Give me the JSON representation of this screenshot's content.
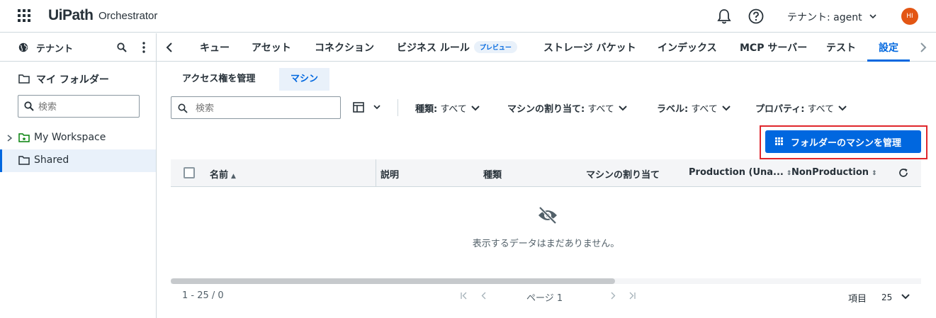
{
  "header": {
    "logo_text": "UiPath",
    "product_name": "Orchestrator",
    "tenant_selector": "テナント: agent",
    "avatar_initials": "HI",
    "avatar_color": "#e35614"
  },
  "sidebar": {
    "header_label": "テナント",
    "folder_section_title": "マイ フォルダー",
    "search_placeholder": "検索",
    "tree": [
      {
        "label": "My Workspace"
      },
      {
        "label": "Shared"
      }
    ]
  },
  "tabs": [
    {
      "label": "キュー"
    },
    {
      "label": "アセット"
    },
    {
      "label": "コネクション"
    },
    {
      "label": "ビジネス ルール",
      "badge": "プレビュー"
    },
    {
      "label": "ストレージ バケット"
    },
    {
      "label": "インデックス"
    },
    {
      "label": "MCP サーバー"
    },
    {
      "label": "テスト"
    },
    {
      "label": "設定"
    }
  ],
  "active_tab": "設定",
  "subtabs": [
    {
      "label": "アクセス権を管理"
    },
    {
      "label": "マシン"
    }
  ],
  "toolbar": {
    "search_placeholder": "検索",
    "filters": [
      {
        "name": "種類:",
        "value": "すべて"
      },
      {
        "name": "マシンの割り当て:",
        "value": "すべて"
      },
      {
        "name": "ラベル:",
        "value": "すべて"
      },
      {
        "name": "プロパティ:",
        "value": "すべて"
      }
    ],
    "manage_button": "フォルダーのマシンを管理"
  },
  "table": {
    "columns": [
      "名前",
      "説明",
      "種類",
      "マシンの割り当て",
      "Production (Una...",
      "NonProduction"
    ],
    "empty_message": "表示するデータはまだありません。"
  },
  "pagination": {
    "range": "1 - 25 / 0",
    "page": "ページ 1",
    "items_label": "項目",
    "items_per_page": "25"
  },
  "colors": {
    "accent": "#0067df",
    "highlight_border": "#e0262b"
  }
}
